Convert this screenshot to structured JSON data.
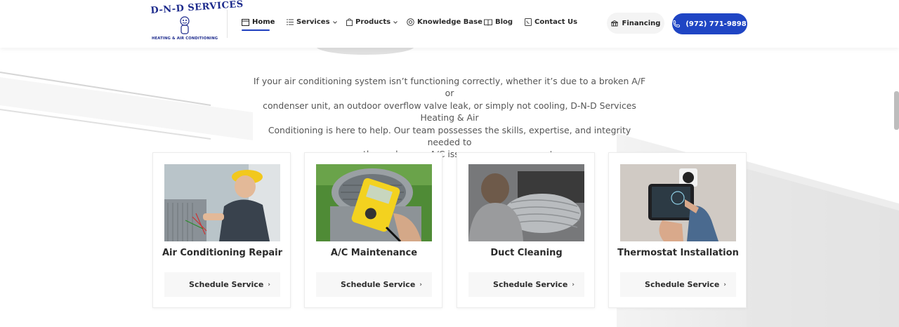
{
  "brand": {
    "logo_word": "D-N-D SERVICES",
    "logo_sub": "HEATING & AIR CONDITIONING"
  },
  "nav": {
    "items": [
      {
        "label": "Home",
        "icon": "browser-window-icon",
        "active": true
      },
      {
        "label": "Services",
        "icon": "list-icon",
        "dropdown": true
      },
      {
        "label": "Products",
        "icon": "shopping-bag-icon",
        "dropdown": true
      },
      {
        "label": "Knowledge Base",
        "icon": "lifebuoy-icon"
      },
      {
        "label": "Blog",
        "icon": "book-icon"
      },
      {
        "label": "Contact Us",
        "icon": "phone-book-icon"
      }
    ],
    "financing_label": "Financing",
    "financing_icon": "bank-icon",
    "phone_label": "(972) 771-9898",
    "phone_icon": "phone-icon"
  },
  "intro": {
    "line1": "If your air conditioning system isn’t functioning correctly, whether it’s due to a broken A/F or",
    "line2": "condenser unit, an outdoor overflow valve leak, or simply not cooling, D-N-D Services Heating & Air",
    "line3": "Conditioning is here to help. Our team possesses the skills, expertise, and integrity needed to",
    "line4": "promptly resolve any A/C issues you may encounter."
  },
  "cards": [
    {
      "title": "Air Conditioning Repair",
      "button": "Schedule Service",
      "image": "technician-repairing-ac-unit"
    },
    {
      "title": "A/C Maintenance",
      "button": "Schedule Service",
      "image": "multimeter-on-ac-condenser"
    },
    {
      "title": "Duct Cleaning",
      "button": "Schedule Service",
      "image": "technician-in-ductwork"
    },
    {
      "title": "Thermostat Installation",
      "button": "Schedule Service",
      "image": "smart-thermostat-tablet"
    }
  ],
  "colors": {
    "accent": "#1f45c4",
    "text": "#2b2b2b",
    "muted": "#555555"
  }
}
